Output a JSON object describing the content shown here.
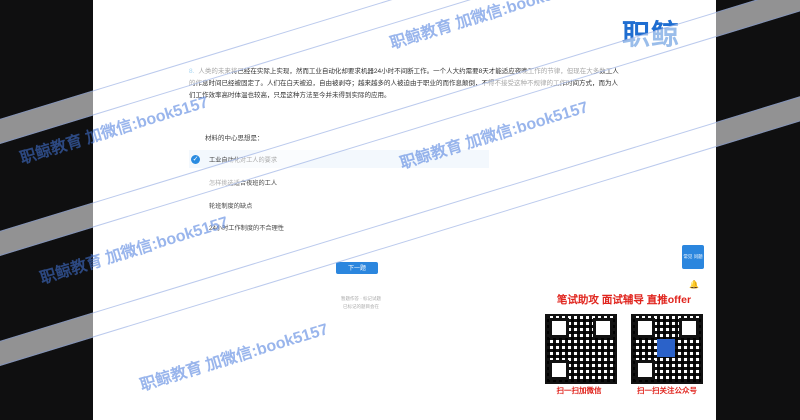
{
  "question": {
    "number": "8.",
    "text": "人类的未来将已经在实际上实现，然而工业自动化却要求机器24小时不间断工作。一个人大约需要8天才能适应夜晚工作的节律，但现在大多数工人的作息时间已经被固定了。人们在白天被迫，自由被剥夺；越来越多的人被迫由于职业的而作息颠倒，不得不接受这种不规律的工作时间方式，而为人们工作效率高时体温也较高，只是这种方法至今并未得到实际的应用。"
  },
  "subquestion": "材料的中心思想是：",
  "options": [
    {
      "label": "工业自动化对工人的要求",
      "selected": true
    },
    {
      "label": "怎样挑选适合夜班的工人",
      "selected": false
    },
    {
      "label": "轮班制度的缺点",
      "selected": false
    },
    {
      "label": "24小时工作制度的不合理性",
      "selected": false
    }
  ],
  "next_button": "下一题",
  "footer": {
    "line1": "暂题作答 · 标记试题",
    "line2": "已标记的题目会在"
  },
  "help_button": "常见\n问题",
  "brand": "职鲸",
  "promo": {
    "title": "笔试助攻  面试辅导  直推offer",
    "qr_left_caption": "扫一扫加微信",
    "qr_right_caption": "扫一扫关注公众号"
  },
  "watermark": "职鲸教育 加微信:book5157"
}
